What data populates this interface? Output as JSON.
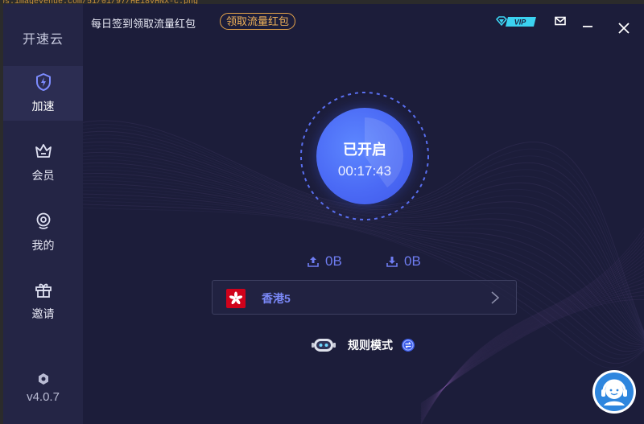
{
  "background_window": {
    "url_fragment": "ps.imagevenue.com/51/01/97/HE18VHNX-c.png"
  },
  "sidebar": {
    "app_title": "开速云",
    "items": [
      {
        "label": "加速",
        "icon": "lightning-shield-icon",
        "active": true
      },
      {
        "label": "会员",
        "icon": "crown-icon",
        "active": false
      },
      {
        "label": "我的",
        "icon": "user-icon",
        "active": false
      },
      {
        "label": "邀请",
        "icon": "gift-icon",
        "active": false
      }
    ],
    "version": "v4.0.7",
    "version_icon": "hexagon-icon"
  },
  "topbar": {
    "promo_text": "每日签到领取流量红包",
    "promo_button": "领取流量红包",
    "vip_label": "VIP",
    "icons": [
      "diamond-vip-icon",
      "mail-icon",
      "minimize-icon",
      "close-icon"
    ]
  },
  "main": {
    "status": "已开启",
    "timer": "00:17:43",
    "upload": "0B",
    "download": "0B",
    "node": {
      "name": "香港5",
      "flag": "hong-kong-flag-icon"
    },
    "mode_label": "规则模式",
    "support_icon": "customer-support-icon"
  },
  "colors": {
    "accent": "#4f6ef7",
    "accent_text": "#7a88f7",
    "promo": "#f1b35a",
    "sidebar_bg": "#242545",
    "window_bg": "#1c1d3a",
    "vip": "#3bd2f0"
  }
}
